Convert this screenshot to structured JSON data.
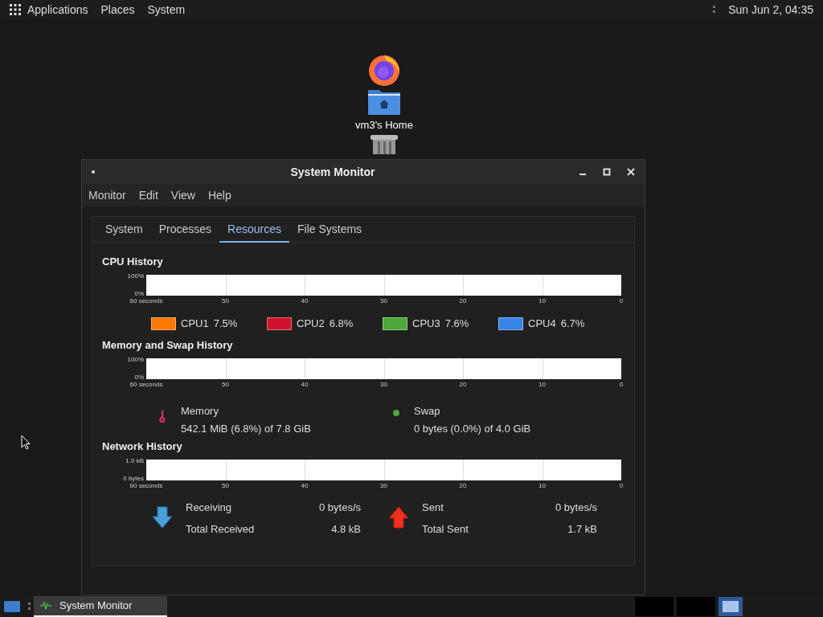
{
  "top_bar": {
    "menus": [
      "Applications",
      "Places",
      "System"
    ],
    "clock": "Sun Jun 2, 04:35"
  },
  "desktop_icons": [
    {
      "kind": "browser"
    },
    {
      "kind": "folder",
      "label": "vm3's Home"
    },
    {
      "kind": "trash"
    }
  ],
  "window": {
    "title": "System Monitor",
    "menu": [
      "Monitor",
      "Edit",
      "View",
      "Help"
    ],
    "tabs": [
      {
        "label": "System",
        "selected": false
      },
      {
        "label": "Processes",
        "selected": false
      },
      {
        "label": "Resources",
        "selected": true
      },
      {
        "label": "File Systems",
        "selected": false
      }
    ],
    "cpu": {
      "title": "CPU History",
      "y_labels": [
        "100%",
        "0%"
      ],
      "x_labels": [
        "60 seconds",
        "50",
        "40",
        "30",
        "20",
        "10",
        "0"
      ],
      "legend": [
        {
          "label": "CPU1",
          "value": "7.5%",
          "color": "#ff7800"
        },
        {
          "label": "CPU2",
          "value": "6.8%",
          "color": "#d0112b"
        },
        {
          "label": "CPU3",
          "value": "7.6%",
          "color": "#4ca838"
        },
        {
          "label": "CPU4",
          "value": "6.7%",
          "color": "#3584e4"
        }
      ]
    },
    "memory": {
      "title": "Memory and Swap History",
      "y_labels": [
        "100%",
        "0%"
      ],
      "x_labels": [
        "60 seconds",
        "50",
        "40",
        "30",
        "20",
        "10",
        "0"
      ],
      "items": [
        {
          "kind": "memory",
          "label": "Memory",
          "value": "542.1 MiB (6.8%) of 7.8 GiB",
          "color": "#d03264"
        },
        {
          "kind": "swap",
          "label": "Swap",
          "value": "0 bytes (0.0%) of 4.0 GiB",
          "color": "#4ca838"
        }
      ]
    },
    "network": {
      "title": "Network History",
      "y_labels": [
        "1.0 kB",
        "0 bytes"
      ],
      "x_labels": [
        "60 seconds",
        "50",
        "40",
        "30",
        "20",
        "10",
        "0"
      ],
      "items": [
        {
          "kind": "receive",
          "label": "Receiving",
          "value": "0 bytes/s",
          "total_label": "Total Received",
          "total": "4.8 kB"
        },
        {
          "kind": "send",
          "label": "Sent",
          "value": "0 bytes/s",
          "total_label": "Total Sent",
          "total": "1.7 kB"
        }
      ]
    }
  },
  "taskbar": {
    "task": "System Monitor",
    "workspaces": [
      {
        "selected": false
      },
      {
        "selected": false
      },
      {
        "selected": true
      }
    ]
  }
}
